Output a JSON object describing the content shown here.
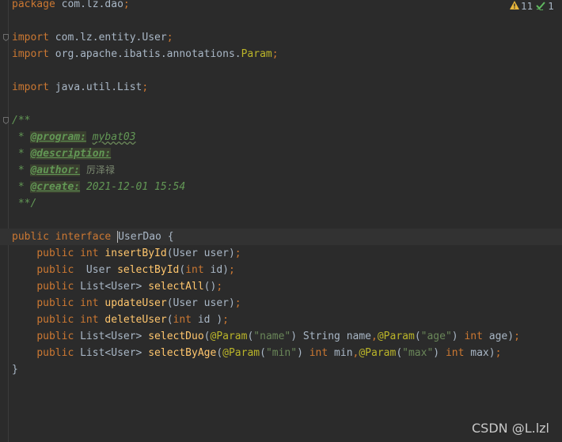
{
  "editor": {
    "inspections": {
      "warnings_count": "11",
      "weak_warnings_count": "1",
      "warning_icon": "warning-triangle-icon",
      "weak_warning_icon": "checkmark-icon"
    },
    "lines": {
      "l1": {
        "kw": "package",
        "rest": " com.lz.dao",
        "semi": ";"
      },
      "l3": {
        "kw": "import",
        "rest": " com.lz.entity.User",
        "semi": ";"
      },
      "l4": {
        "kw": "import",
        "rest": " org.apache.ibatis.annotations.",
        "cls": "Param",
        "semi": ";"
      },
      "l6": {
        "kw": "import",
        "rest": " java.util.List",
        "semi": ";"
      },
      "l8": {
        "text": "/**"
      },
      "l9": {
        "prefix": " * ",
        "tag": "@program:",
        "value": "mybat03"
      },
      "l10": {
        "prefix": " * ",
        "tag": "@description:"
      },
      "l11": {
        "prefix": " * ",
        "tag": "@author:",
        "value": "厉泽禄"
      },
      "l12": {
        "prefix": " * ",
        "tag": "@create:",
        "value": "2021-12-01 15:54"
      },
      "l13": {
        "text": " **/"
      },
      "l15": {
        "kw1": "public",
        "kw2": "interface",
        "name": "UserDao",
        "brace": " {"
      },
      "l16": {
        "kw": "public",
        "type": "int",
        "fn": "insertById",
        "open": "(User user)",
        "semi": ";"
      },
      "l17": {
        "kw": "public",
        "type": "  User",
        "fn": "selectById",
        "p1": "(",
        "ptype": "int",
        "p2": " id)",
        "semi": ";"
      },
      "l18": {
        "kw": "public",
        "type": "List<User>",
        "fn": "selectAll",
        "open": "()",
        "semi": ";"
      },
      "l19": {
        "kw": "public",
        "type": "int",
        "fn": "updateUser",
        "open": "(User user)",
        "semi": ";"
      },
      "l20": {
        "kw": "public",
        "type": "int",
        "fn": "deleteUser",
        "p1": "(",
        "ptype": "int",
        "p2": " id )",
        "semi": ";"
      },
      "l21": {
        "kw": "public",
        "type": "List<User>",
        "fn": "selectDuo",
        "p1": "(",
        "a1": "@Param",
        "s1": "(",
        "str1": "\"name\"",
        "s2": ") String name",
        "c1": ",",
        "a2": "@Param",
        "s3": "(",
        "str2": "\"age\"",
        "s4": ") ",
        "t2": "int",
        "s5": " age)",
        "semi": ";"
      },
      "l22": {
        "kw": "public",
        "type": "List<User>",
        "fn": "selectByAge",
        "p1": "(",
        "a1": "@Param",
        "s1": "(",
        "str1": "\"min\"",
        "s2": ") ",
        "t1": "int",
        "s2b": " min",
        "c1": ",",
        "a2": "@Param",
        "s3": "(",
        "str2": "\"max\"",
        "s4": ") ",
        "t2": "int",
        "s5": " max)",
        "semi": ";"
      },
      "l23": {
        "text": "}"
      }
    }
  },
  "watermark": "CSDN @L.lzl"
}
